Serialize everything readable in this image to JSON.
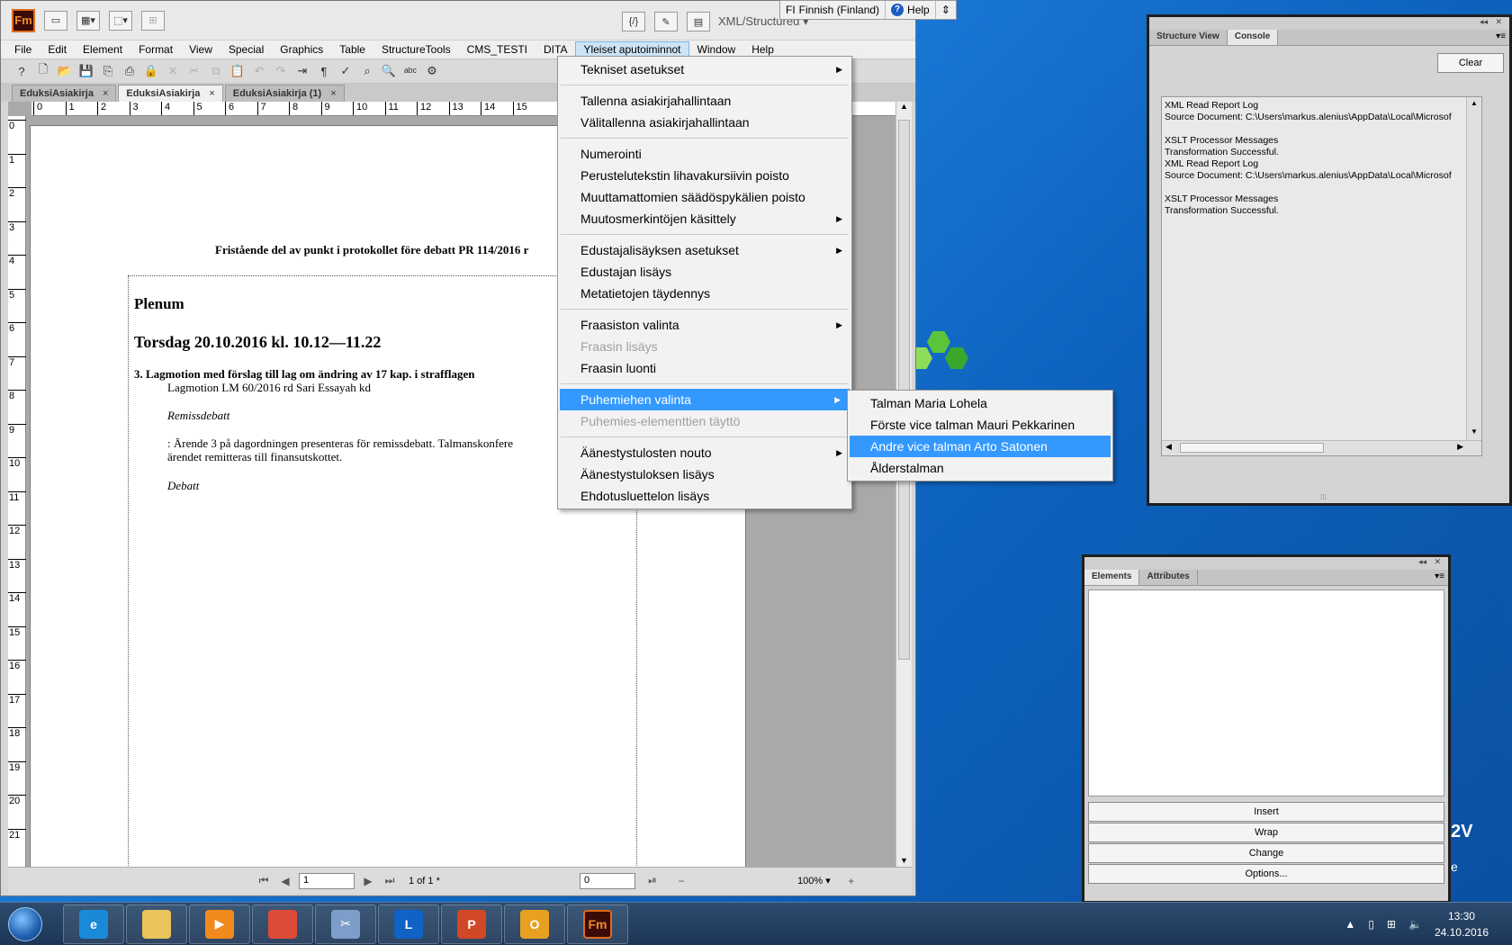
{
  "language_bar": {
    "lang_code": "FI",
    "lang_name": "Finnish (Finland)",
    "help_label": "Help"
  },
  "app": {
    "logo": "Fm",
    "workspace": "XML/Structured",
    "menu": [
      "File",
      "Edit",
      "Element",
      "Format",
      "View",
      "Special",
      "Graphics",
      "Table",
      "StructureTools",
      "CMS_TESTI",
      "DITA",
      "Yleiset aputoiminnot",
      "Window",
      "Help"
    ],
    "open_menu": "Yleiset aputoiminnot",
    "toolbar_icons": [
      "help-icon",
      "new-icon",
      "open-icon",
      "save-icon",
      "save-as-icon",
      "print-icon",
      "lock-icon",
      "delete-icon",
      "cut-icon",
      "copy-icon",
      "paste-icon",
      "undo-icon",
      "redo-icon",
      "import-icon",
      "format-icon",
      "spell-icon",
      "zoom-icon",
      "find-icon",
      "abc-icon",
      "structure-icon"
    ],
    "tabs": [
      {
        "label": "EduksiAsiakirja",
        "active": false
      },
      {
        "label": "EduksiAsiakirja",
        "active": true
      },
      {
        "label": "EduksiAsiakirja (1)",
        "active": false
      }
    ],
    "ruler_h": [
      "0",
      "1",
      "2",
      "3",
      "4",
      "5",
      "6",
      "7",
      "8",
      "9",
      "10",
      "11",
      "12",
      "13",
      "14",
      "15"
    ],
    "ruler_v": [
      "0",
      "1",
      "2",
      "3",
      "4",
      "5",
      "6",
      "7",
      "8",
      "9",
      "10",
      "11",
      "12",
      "13",
      "14",
      "15",
      "16",
      "17",
      "18",
      "19",
      "20",
      "21"
    ]
  },
  "document": {
    "header_title": "Fristående del av punkt i protokollet före debatt PR 114/2016 r",
    "plenum": "Plenum",
    "date": "Torsdag 20.10.2016 kl. 10.12—11.22",
    "item": "3. Lagmotion med förslag till lag om ändring av 17 kap. i strafflagen",
    "sub": "Lagmotion LM 60/2016 rd Sari Essayah kd",
    "remiss": "Remissdebatt",
    "para1": ": Ärende 3 på dagordningen presenteras för remissdebatt. Talmanskonfere",
    "para2": "ärendet remitteras till finansutskottet.",
    "debatt": "Debatt"
  },
  "statusbar": {
    "page_input": "1",
    "page_of": "1 of 1 *",
    "field2": "0",
    "zoom": "100%"
  },
  "dropdown": {
    "groups": [
      [
        {
          "label": "Tekniset asetukset",
          "submenu": true
        }
      ],
      [
        {
          "label": "Tallenna asiakirjahallintaan"
        },
        {
          "label": "Välitallenna asiakirjahallintaan"
        }
      ],
      [
        {
          "label": "Numerointi"
        },
        {
          "label": "Perustelutekstin lihavakursiivin poisto"
        },
        {
          "label": "Muuttamattomien säädöspykälien poisto"
        },
        {
          "label": "Muutosmerkintöjen käsittely",
          "submenu": true
        }
      ],
      [
        {
          "label": "Edustajalisäyksen asetukset",
          "submenu": true
        },
        {
          "label": "Edustajan lisäys"
        },
        {
          "label": "Metatietojen täydennys"
        }
      ],
      [
        {
          "label": "Fraasiston valinta",
          "submenu": true
        },
        {
          "label": "Fraasin lisäys",
          "disabled": true
        },
        {
          "label": "Fraasin luonti"
        }
      ],
      [
        {
          "label": "Puhemiehen valinta",
          "submenu": true,
          "highlighted": true
        },
        {
          "label": "Puhemies-elementtien täyttö",
          "disabled": true
        }
      ],
      [
        {
          "label": "Äänestystulosten nouto",
          "submenu": true
        },
        {
          "label": "Äänestystuloksen lisäys"
        },
        {
          "label": "Ehdotusluettelon lisäys"
        }
      ]
    ]
  },
  "submenu": {
    "items": [
      {
        "label": "Talman Maria Lohela"
      },
      {
        "label": "Förste vice talman Mauri Pekkarinen"
      },
      {
        "label": "Andre vice talman Arto Satonen",
        "highlighted": true
      },
      {
        "label": "Ålderstalman"
      }
    ]
  },
  "console_panel": {
    "tabs": [
      "Structure View",
      "Console"
    ],
    "active_tab": "Console",
    "clear_label": "Clear",
    "lines": [
      "XML Read Report Log",
      "Source Document: C:\\Users\\markus.alenius\\AppData\\Local\\Microsof",
      "",
      "XSLT Processor Messages",
      "Transformation Successful.",
      "XML Read Report Log",
      "Source Document: C:\\Users\\markus.alenius\\AppData\\Local\\Microsof",
      "",
      "XSLT Processor Messages",
      "Transformation Successful."
    ]
  },
  "elements_panel": {
    "tabs": [
      "Elements",
      "Attributes"
    ],
    "buttons": [
      "Insert",
      "Wrap",
      "Change",
      "Options..."
    ]
  },
  "desktop": {
    "text": "2V",
    "text2": "e"
  },
  "taskbar": {
    "apps": [
      {
        "name": "internet-explorer-icon",
        "label": "e",
        "color": "#1a8ad8"
      },
      {
        "name": "file-explorer-icon",
        "label": "",
        "color": "#e8c45a"
      },
      {
        "name": "media-player-icon",
        "label": "▶",
        "color": "#f08a1c"
      },
      {
        "name": "chrome-icon",
        "label": "",
        "color": "#dd4b39"
      },
      {
        "name": "snipping-tool-icon",
        "label": "✂",
        "color": "#7d9ec8"
      },
      {
        "name": "lync-icon",
        "label": "L",
        "color": "#1062c4"
      },
      {
        "name": "powerpoint-icon",
        "label": "P",
        "color": "#d24726"
      },
      {
        "name": "outlook-icon",
        "label": "O",
        "color": "#e8a020"
      },
      {
        "name": "framemaker-icon",
        "label": "Fm",
        "color": "#3b0b07"
      }
    ],
    "time": "13:30",
    "date": "24.10.2016"
  }
}
